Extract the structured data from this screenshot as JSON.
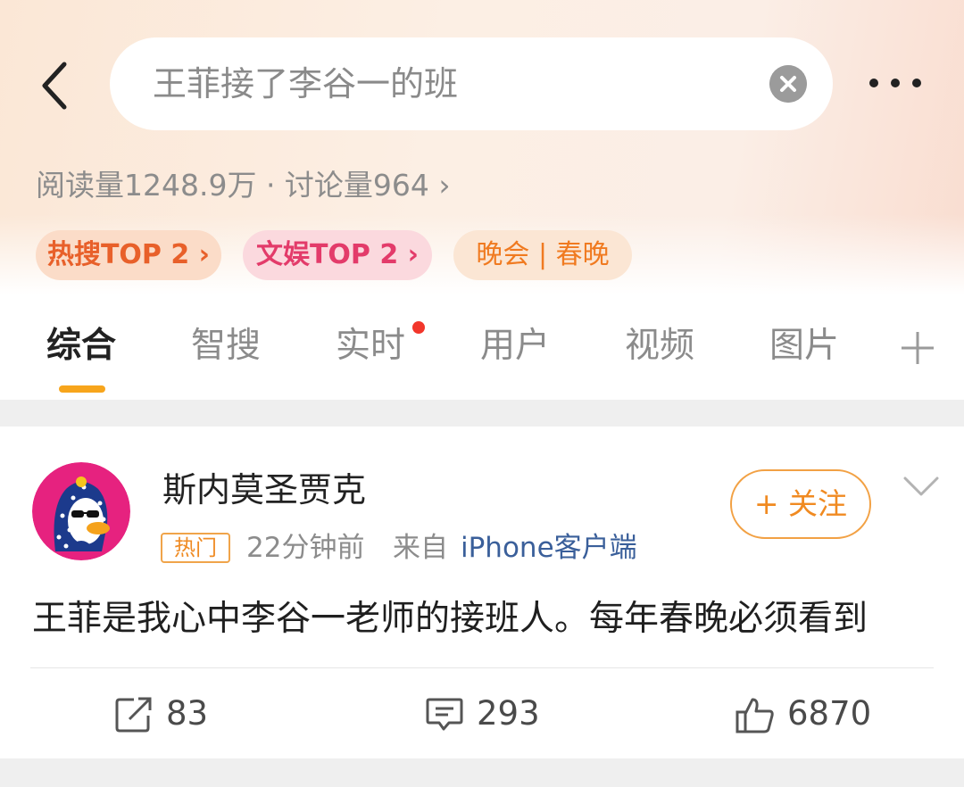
{
  "search": {
    "query": "王菲接了李谷一的班"
  },
  "stats": {
    "text": "阅读量1248.9万 · 讨论量964 ›"
  },
  "tags": [
    "热搜TOP 2 ›",
    "文娱TOP 2 ›",
    "晚会 | 春晚"
  ],
  "tabs": [
    "综合",
    "智搜",
    "实时",
    "用户",
    "视频",
    "图片"
  ],
  "post": {
    "username": "斯内莫圣贾克",
    "badge": "热门",
    "time": "22分钟前",
    "source_prefix": "来自",
    "source": "iPhone客户端",
    "follow_label": "+ 关注",
    "text": "王菲是我心中李谷一老师的接班人。每年春晚必须看到",
    "reposts": "83",
    "comments": "293",
    "likes": "6870"
  },
  "colors": {
    "accent": "#f7a51c",
    "hot_tag": "#e8602a",
    "ent_tag": "#e33b6a",
    "follow": "#f08a21",
    "source_link": "#3a5f9a"
  },
  "icons": [
    "back-icon",
    "clear-icon",
    "more-icon",
    "plus-icon",
    "chevron-down-icon",
    "share-icon",
    "comment-icon",
    "like-icon"
  ]
}
